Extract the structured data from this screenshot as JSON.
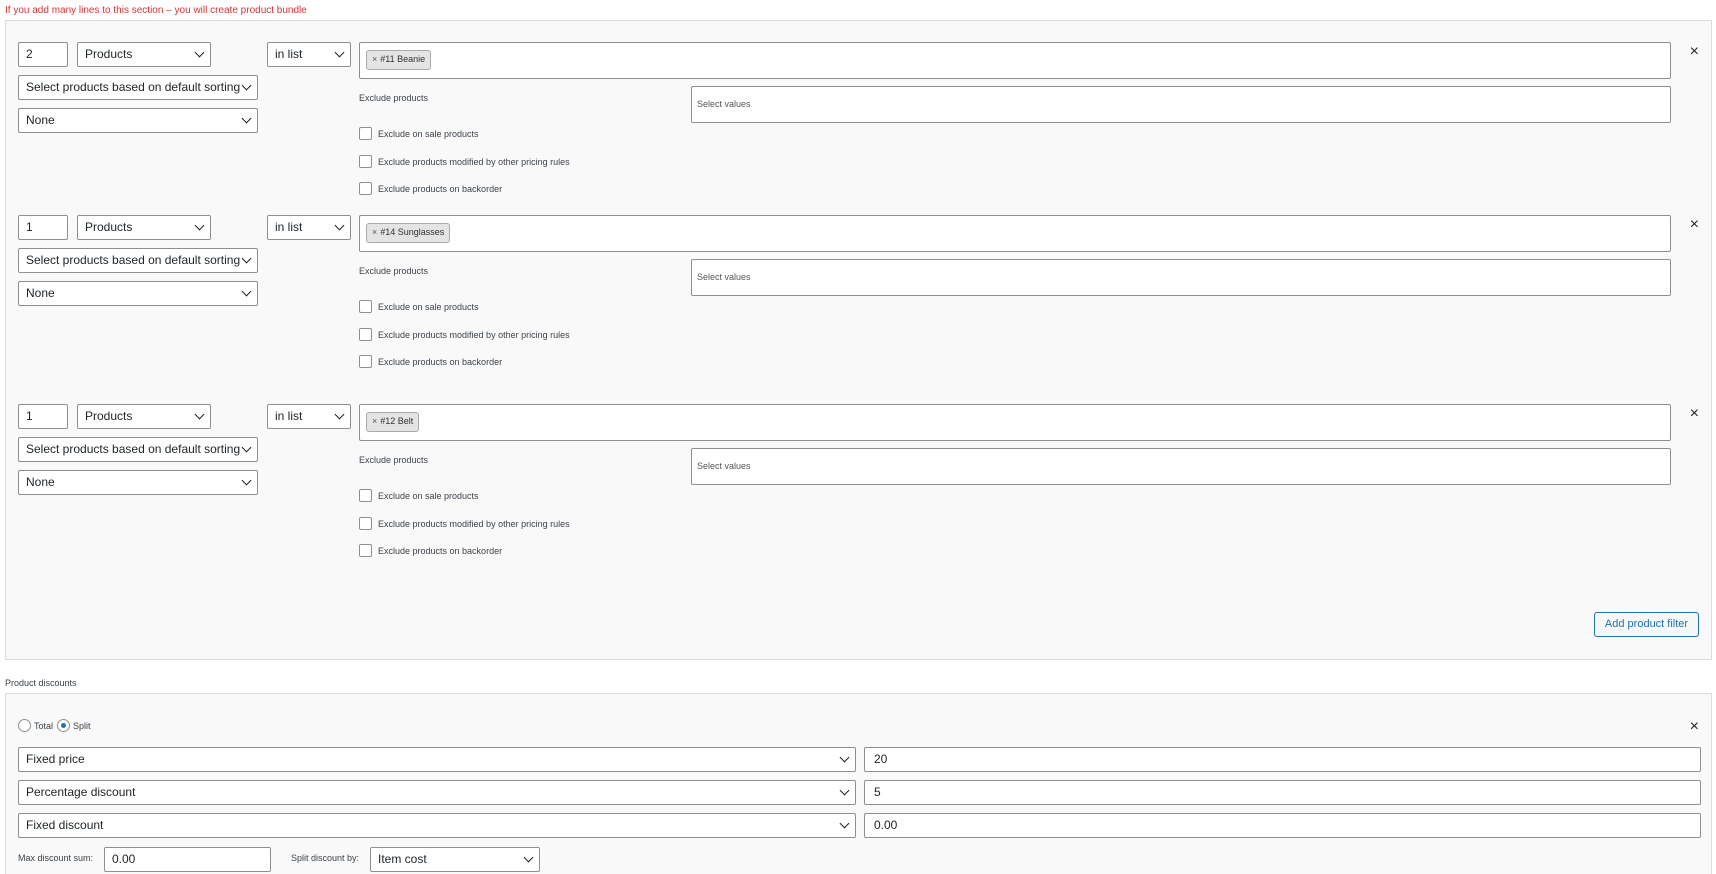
{
  "warning": "If you add many lines to this section – you will create product bundle",
  "filters": [
    {
      "qty": "2",
      "type": "Products",
      "method": "in list",
      "sorting": "Select products based on default sorting",
      "limit": "None",
      "tag": "#11 Beanie",
      "exclude_label": "Exclude products",
      "exclude_placeholder": "Select values",
      "cb1": "Exclude on sale products",
      "cb2": "Exclude products modified by other pricing rules",
      "cb3": "Exclude products on backorder"
    },
    {
      "qty": "1",
      "type": "Products",
      "method": "in list",
      "sorting": "Select products based on default sorting",
      "limit": "None",
      "tag": "#14 Sunglasses",
      "exclude_label": "Exclude products",
      "exclude_placeholder": "Select values",
      "cb1": "Exclude on sale products",
      "cb2": "Exclude products modified by other pricing rules",
      "cb3": "Exclude products on backorder"
    },
    {
      "qty": "1",
      "type": "Products",
      "method": "in list",
      "sorting": "Select products based on default sorting",
      "limit": "None",
      "tag": "#12 Belt",
      "exclude_label": "Exclude products",
      "exclude_placeholder": "Select values",
      "cb1": "Exclude on sale products",
      "cb2": "Exclude products modified by other pricing rules",
      "cb3": "Exclude products on backorder"
    }
  ],
  "add_filter_label": "Add product filter",
  "remove_icon": "×",
  "tag_remove_icon": "×",
  "discounts": {
    "section_label": "Product discounts",
    "radio_total": "Total",
    "radio_split": "Split",
    "selected_mode": "Split",
    "rows": [
      {
        "type": "Fixed price",
        "value": "20"
      },
      {
        "type": "Percentage discount",
        "value": "5"
      },
      {
        "type": "Fixed discount",
        "value": "0.00"
      }
    ],
    "max_label": "Max discount sum:",
    "max_value": "0.00",
    "split_label": "Split discount by:",
    "split_value": "Item cost"
  },
  "colors": {
    "warning": "#d63638",
    "accent": "#2271b1",
    "panel_bg": "#f9f9f9",
    "border": "#8c8f94"
  }
}
